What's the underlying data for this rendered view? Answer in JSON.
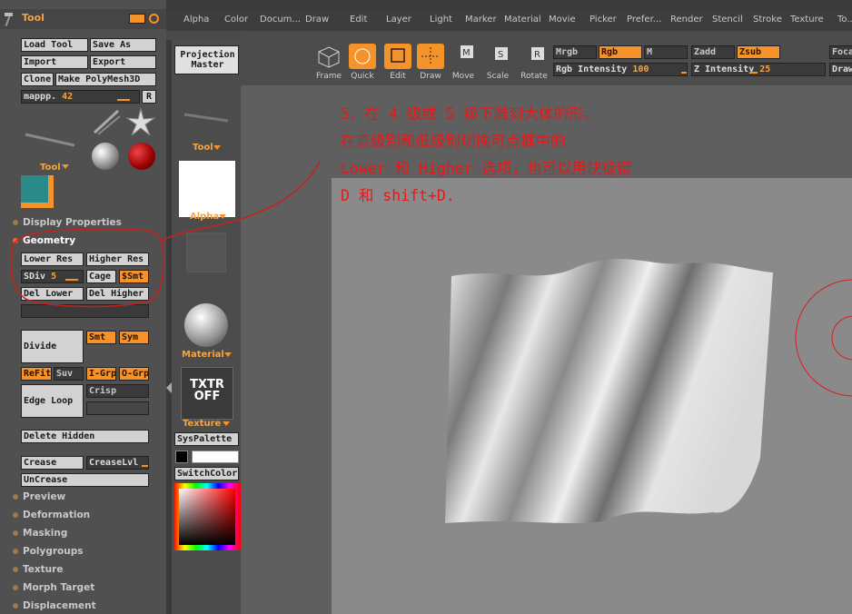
{
  "menubar": {
    "items": [
      "Alpha",
      "Color",
      "Docum...",
      "Draw",
      "Edit",
      "Layer",
      "Light",
      "Marker",
      "Material",
      "Movie",
      "Picker",
      "Prefer...",
      "Render",
      "Stencil",
      "Stroke",
      "Texture",
      "To..."
    ]
  },
  "tool_panel": {
    "title": "Tool",
    "load_tool": "Load Tool",
    "save_as": "Save As",
    "import": "Import",
    "export": "Export",
    "clone": "Clone",
    "make_polymesh": "Make PolyMesh3D",
    "mappp_label": "mappp.",
    "mappp_value": "42",
    "r_button": "R",
    "tool_sub_label": "Tool",
    "display_properties": "Display Properties",
    "geometry": "Geometry",
    "lower_res": "Lower Res",
    "higher_res": "Higher Res",
    "sdiv_label": "SDiv",
    "sdiv_value": "5",
    "cage": "Cage",
    "ssmt": "$Smt",
    "del_lower": "Del Lower",
    "del_higher": "Del Higher",
    "divide": "Divide",
    "smt": "Smt",
    "sym": "Sym",
    "refit": "ReFit",
    "suv": "Suv",
    "igrp": "I-Grp",
    "ogrp": "O-Grp",
    "edge_loop": "Edge Loop",
    "crisp": "Crisp",
    "delete_hidden": "Delete Hidden",
    "crease": "Crease",
    "crease_lvl": "CreaseLvl",
    "uncrease": "UnCrease",
    "sections": [
      "Preview",
      "Deformation",
      "Masking",
      "Polygroups",
      "Texture",
      "Morph Target",
      "Displacement"
    ]
  },
  "mid_column": {
    "projection_master": "Projection Master",
    "tool_label": "Tool",
    "alpha_label": "Alpha",
    "material_label": "Material",
    "txtr_off": "TXTR OFF",
    "texture_label": "Texture",
    "syspalette": "SysPalette",
    "switchcolor": "SwitchColor"
  },
  "shelf": {
    "frame": "Frame",
    "quick": "Quick",
    "edit": "Edit",
    "draw": "Draw",
    "move": "Move",
    "scale": "Scale",
    "rotate": "Rotate",
    "mrgb": "Mrgb",
    "rgb": "Rgb",
    "m": "M",
    "zadd": "Zadd",
    "zsub": "Zsub",
    "focal": "Foca",
    "rgb_intensity_label": "Rgb Intensity",
    "rgb_intensity_value": "100",
    "z_intensity_label": "Z Intensity",
    "z_intensity_value": "25",
    "draw_size": "Draw"
  },
  "annotation": {
    "line1": "5．在 4 级或 5 级下雕刻大体的形。",
    "line2": "在高级别和低级别切换可点框中的",
    "line3": "Lower 和 Higher 选项，也可以用快捷键",
    "line4": "D 和 shift+D."
  },
  "colors": {
    "accent": "#f5922a",
    "annotation_red": "#e81818"
  }
}
